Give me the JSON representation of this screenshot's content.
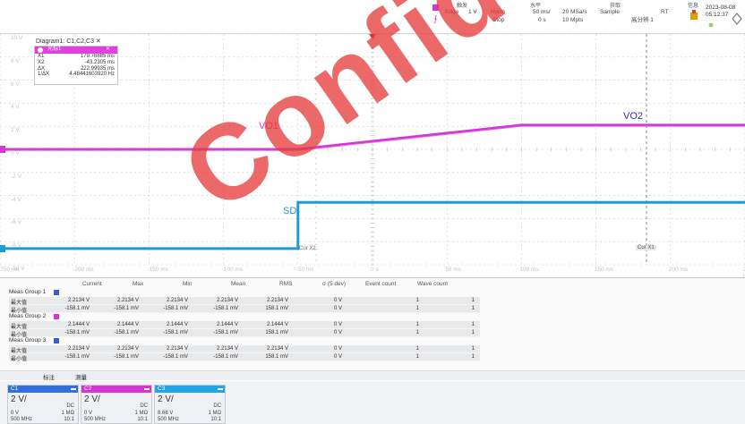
{
  "topbar": {
    "trigger": {
      "caption": "触发",
      "type": "Edge",
      "level": "1 V",
      "mode": "Norm",
      "state": "Stop"
    },
    "horizontal": {
      "caption": "水平",
      "scale": "50 ms/",
      "offset": "0 s"
    },
    "acquire": {
      "caption": "获取",
      "rate": "20 MSa/s",
      "mode": "Sample",
      "pts": "10 Mpts",
      "extra": "高分辨 1",
      "rt": "RT"
    },
    "info": {
      "caption": "信息"
    },
    "date": "2023-08-08",
    "time": "05:12:37"
  },
  "plot": {
    "diagram_title": "Diagram1: C1,C2,C3 ✕",
    "y_labels": [
      "10 V",
      "8 V",
      "6 V",
      "4 V",
      "2 V",
      "0 V",
      "-2 V",
      "-4 V",
      "-6 V",
      "-8 V",
      "-10 V"
    ],
    "x_labels": [
      "-250 ms",
      "-200 ms",
      "-150 ms",
      "-100 ms",
      "-50 ms",
      "0 s",
      "50 ms",
      "100 ms",
      "150 ms",
      "200 ms",
      "250 ms"
    ],
    "signals": [
      {
        "name": "VO1",
        "color": "#d535d5"
      },
      {
        "name": "VO2",
        "color": "#3030c8"
      },
      {
        "name": "SD",
        "color": "#1e9bd7"
      }
    ],
    "markers": {
      "cx2": "Cur X2",
      "cx1": "Cur X1"
    },
    "cursor": {
      "title": "光标1",
      "rows": [
        {
          "label": "X1",
          "value": "179.76885 ms"
        },
        {
          "label": "X2",
          "value": "-43.2305 ms"
        },
        {
          "label": "ΔX",
          "value": "222.99935 ms"
        },
        {
          "label": "1/ΔX",
          "value": "4.48441603920 Hz"
        }
      ]
    },
    "colors": {
      "vo": "#d535d5",
      "sd": "#1e9bd7",
      "grid": "#c8ccd2",
      "trigger": "#e03030"
    }
  },
  "measure": {
    "columns": [
      "Current",
      "Max",
      "Min",
      "Mean",
      "RMS",
      "σ (5 dev)",
      "Event count",
      "Wave count"
    ],
    "groups": [
      {
        "name": "Meas Group 1",
        "color": "#3b5bdb",
        "rows": [
          {
            "label": "最大值",
            "cells": [
              "2.2134 V",
              "2.2134 V",
              "2.2134 V",
              "2.2134 V",
              "2.2134 V",
              "0 V",
              "1",
              "1"
            ]
          },
          {
            "label": "最小值",
            "cells": [
              "-158.1 mV",
              "-158.1 mV",
              "-158.1 mV",
              "-158.1 mV",
              "158.1 mV",
              "0 V",
              "1",
              "1"
            ]
          }
        ]
      },
      {
        "name": "Meas Group 2",
        "color": "#d535d5",
        "rows": [
          {
            "label": "最大值",
            "cells": [
              "2.1444 V",
              "2.1444 V",
              "2.1444 V",
              "2.1444 V",
              "2.1444 V",
              "0 V",
              "1",
              "1"
            ]
          },
          {
            "label": "最小值",
            "cells": [
              "-158.1 mV",
              "-158.1 mV",
              "-158.1 mV",
              "-158.1 mV",
              "158.1 mV",
              "0 V",
              "1",
              "1"
            ]
          }
        ]
      },
      {
        "name": "Meas Group 3",
        "color": "#3b5bdb",
        "rows": [
          {
            "label": "最大值",
            "cells": [
              "2.2134 V",
              "2.2134 V",
              "2.2134 V",
              "2.2134 V",
              "2.2134 V",
              "0 V",
              "1",
              "1"
            ]
          },
          {
            "label": "最小值",
            "cells": [
              "-158.1 mV",
              "-158.1 mV",
              "-158.1 mV",
              "-158.1 mV",
              "158.1 mV",
              "0 V",
              "1",
              "1"
            ]
          }
        ]
      }
    ],
    "tabs": [
      "标注",
      "测量"
    ]
  },
  "channels": [
    {
      "id": "C1",
      "color": "#2f6fe0",
      "scale": "2 V/",
      "coupling": "DC",
      "offset": "0 V",
      "impedance": "1 MΩ",
      "bw": "500 MHz",
      "probe": "10:1"
    },
    {
      "id": "C2",
      "color": "#d535d5",
      "scale": "2 V/",
      "coupling": "DC",
      "offset": "0 V",
      "impedance": "1 MΩ",
      "bw": "500 MHz",
      "probe": "10:1"
    },
    {
      "id": "C3",
      "color": "#20a6e8",
      "scale": "2 V/",
      "coupling": "DC",
      "offset": "8.68 V",
      "impedance": "1 MΩ",
      "bw": "500 MHz",
      "probe": "10:1"
    }
  ],
  "watermark": "Confid"
}
